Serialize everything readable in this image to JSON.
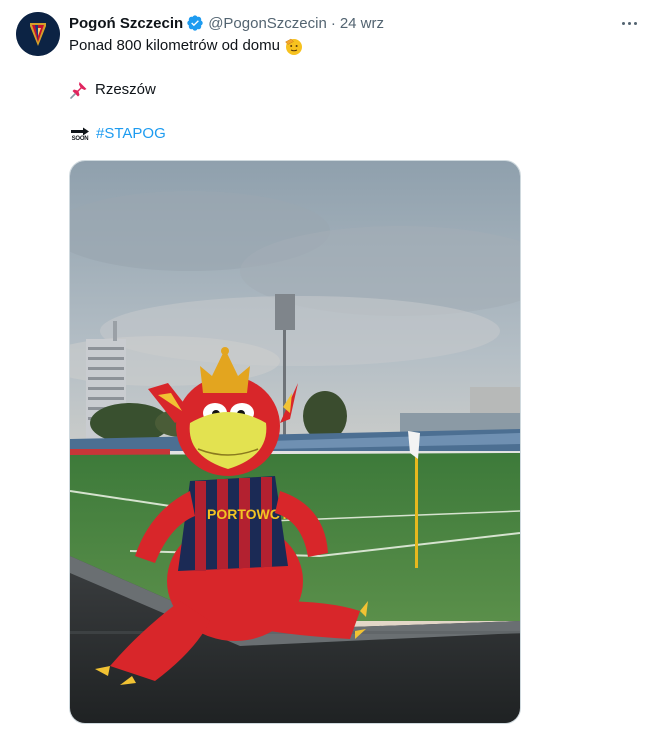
{
  "tweet": {
    "author_name": "Pogoń Szczecin",
    "handle": "@PogonSzczecin",
    "separator": "·",
    "date": "24 wrz",
    "lines": {
      "line1": "Ponad 800 kilometrów od domu",
      "line2": "Rzeszów",
      "line3": "#STAPOG"
    },
    "soon_label": "SOON",
    "mascot_shirt_text": "PORTOWCY"
  },
  "icons": {
    "avatar": "club-crest-icon",
    "verified": "verified-badge-icon",
    "more": "more-options-icon",
    "emoji1": "saluting-face-icon",
    "emoji2": "pushpin-icon",
    "emoji3": "soon-arrow-icon"
  },
  "colors": {
    "link": "#1d9bf0",
    "verified": "#1d9bf0",
    "secondary_text": "#536471",
    "primary_text": "#0f1419"
  }
}
